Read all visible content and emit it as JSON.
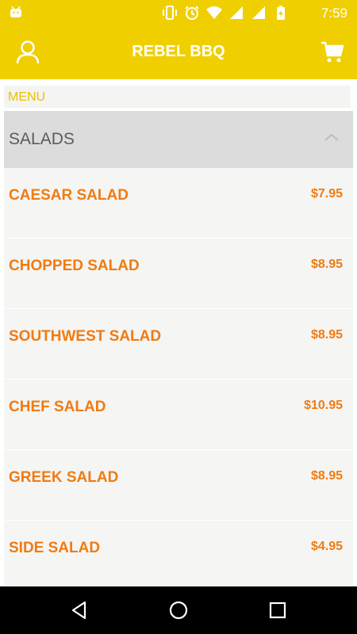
{
  "status_bar": {
    "time": "7:59",
    "icons": [
      "android-icon",
      "vibrate-icon",
      "alarm-icon",
      "wifi-icon",
      "signal-icon",
      "signal-icon",
      "battery-charging-icon"
    ]
  },
  "app_bar": {
    "title": "REBEL BBQ",
    "left_icon": "user-icon",
    "right_icon": "cart-icon"
  },
  "menu": {
    "label": "MENU",
    "category": {
      "name": "SALADS",
      "expanded": true,
      "items": [
        {
          "name": "CAESAR SALAD",
          "price": "$7.95"
        },
        {
          "name": "CHOPPED SALAD",
          "price": "$8.95"
        },
        {
          "name": "SOUTHWEST SALAD",
          "price": "$8.95"
        },
        {
          "name": "CHEF SALAD",
          "price": "$10.95"
        },
        {
          "name": "GREEK SALAD",
          "price": "$8.95"
        },
        {
          "name": "SIDE SALAD",
          "price": "$4.95"
        }
      ]
    }
  },
  "colors": {
    "brand_yellow": "#f0cf00",
    "item_orange": "#f07b12",
    "menu_label": "#e8c200",
    "category_bg": "#dcdcdc"
  }
}
